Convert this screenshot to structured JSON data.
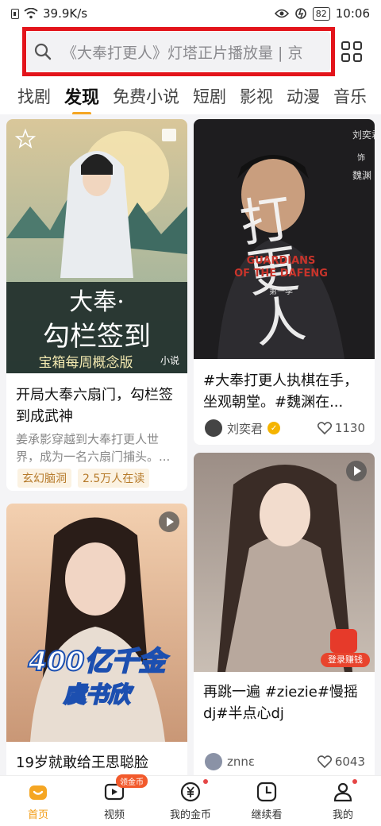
{
  "status_bar": {
    "network_speed": "39.9K/s",
    "battery": "82",
    "time": "10:06"
  },
  "search": {
    "placeholder": "《大奉打更人》灯塔正片播放量 | 京"
  },
  "tabs": [
    {
      "label": "找剧"
    },
    {
      "label": "发现",
      "active": true
    },
    {
      "label": "免费小说"
    },
    {
      "label": "短剧"
    },
    {
      "label": "影视"
    },
    {
      "label": "动漫"
    },
    {
      "label": "音乐"
    }
  ],
  "feed": {
    "card1": {
      "overlay_title": "大奉·",
      "overlay_line2": "勾栏签到",
      "overlay_line3": "宝箱每周概念版",
      "badge": "小说",
      "title": "开局大奉六扇门，勾栏签到成武神",
      "desc": "姜承影穿越到大奉打更人世界，成为一名六扇门捕头。...",
      "tags": [
        "玄幻脑洞",
        "2.5万人在读"
      ]
    },
    "card2": {
      "poster_text": "打更人",
      "poster_en_1": "GUARDIANS",
      "poster_en_2": "OF THE DAFENG",
      "poster_season": "第一季",
      "poster_actor": "刘奕君",
      "poster_as": "饰",
      "poster_role": "魏渊",
      "title": "#大奉打更人执棋在手，坐观朝堂。#魏渊在...",
      "author": "刘奕君",
      "likes": "1130"
    },
    "card3": {
      "overlay_line1": "400亿千金",
      "overlay_line2": "虞书欣",
      "title": "19岁就敢给王思聪脸"
    },
    "card4": {
      "title": "再跳一遍 #ziezie#慢摇dj#半点心dj",
      "author": "znnε",
      "likes": "6043",
      "promo": "登录赚钱"
    }
  },
  "bottom_nav": [
    {
      "label": "首页",
      "active": true
    },
    {
      "label": "视频",
      "badge": "领金币"
    },
    {
      "label": "我的金币"
    },
    {
      "label": "继续看"
    },
    {
      "label": "我的"
    }
  ],
  "colors": {
    "accent": "#f5a623",
    "highlight_border": "#e3141b"
  }
}
